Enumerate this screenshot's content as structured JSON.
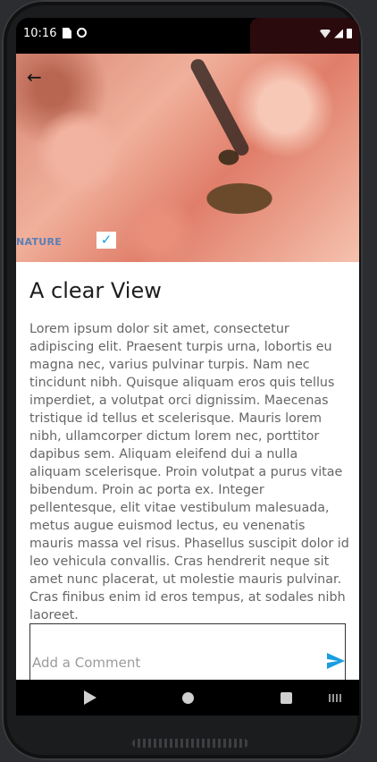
{
  "status_bar": {
    "time": "10:16",
    "icons": [
      "sim-icon",
      "sync-icon",
      "wifi-icon",
      "signal-icon",
      "battery-icon"
    ]
  },
  "hero": {
    "back_icon": "arrow-left-icon",
    "back_glyph": "←",
    "category_tag": "NATURE",
    "checkbox_checked": true,
    "check_glyph": "✓"
  },
  "article": {
    "title": "A clear View",
    "body": "Lorem ipsum dolor sit amet, consectetur adipiscing elit. Praesent turpis urna, lobortis eu magna nec, varius pulvinar turpis. Nam nec tincidunt nibh. Quisque aliquam eros quis tellus imperdiet, a volutpat orci dignissim. Maecenas tristique id tellus et scelerisque. Mauris lorem nibh, ullamcorper dictum lorem nec, porttitor dapibus sem. Aliquam eleifend dui a nulla aliquam scelerisque. Proin volutpat a purus vitae bibendum. Proin ac porta ex. Integer pellentesque, elit vitae vestibulum malesuada, metus augue euismod lectus, eu venenatis mauris massa vel risus. Phasellus suscipit dolor id leo vehicula convallis. Cras hendrerit neque sit amet nunc placerat, ut molestie mauris pulvinar. Cras finibus enim id eros tempus, at sodales nibh laoreet."
  },
  "comment": {
    "placeholder": "Add a Comment",
    "value": "",
    "send_icon": "send-icon"
  },
  "nav_bar": {
    "buttons": [
      "back-triangle-icon",
      "home-circle-icon",
      "recents-square-icon",
      "keyboard-icon"
    ]
  },
  "colors": {
    "accent": "#1a9ee0",
    "tag": "#5a7fb6",
    "title": "#1d1d1d",
    "body_text": "#666666"
  }
}
